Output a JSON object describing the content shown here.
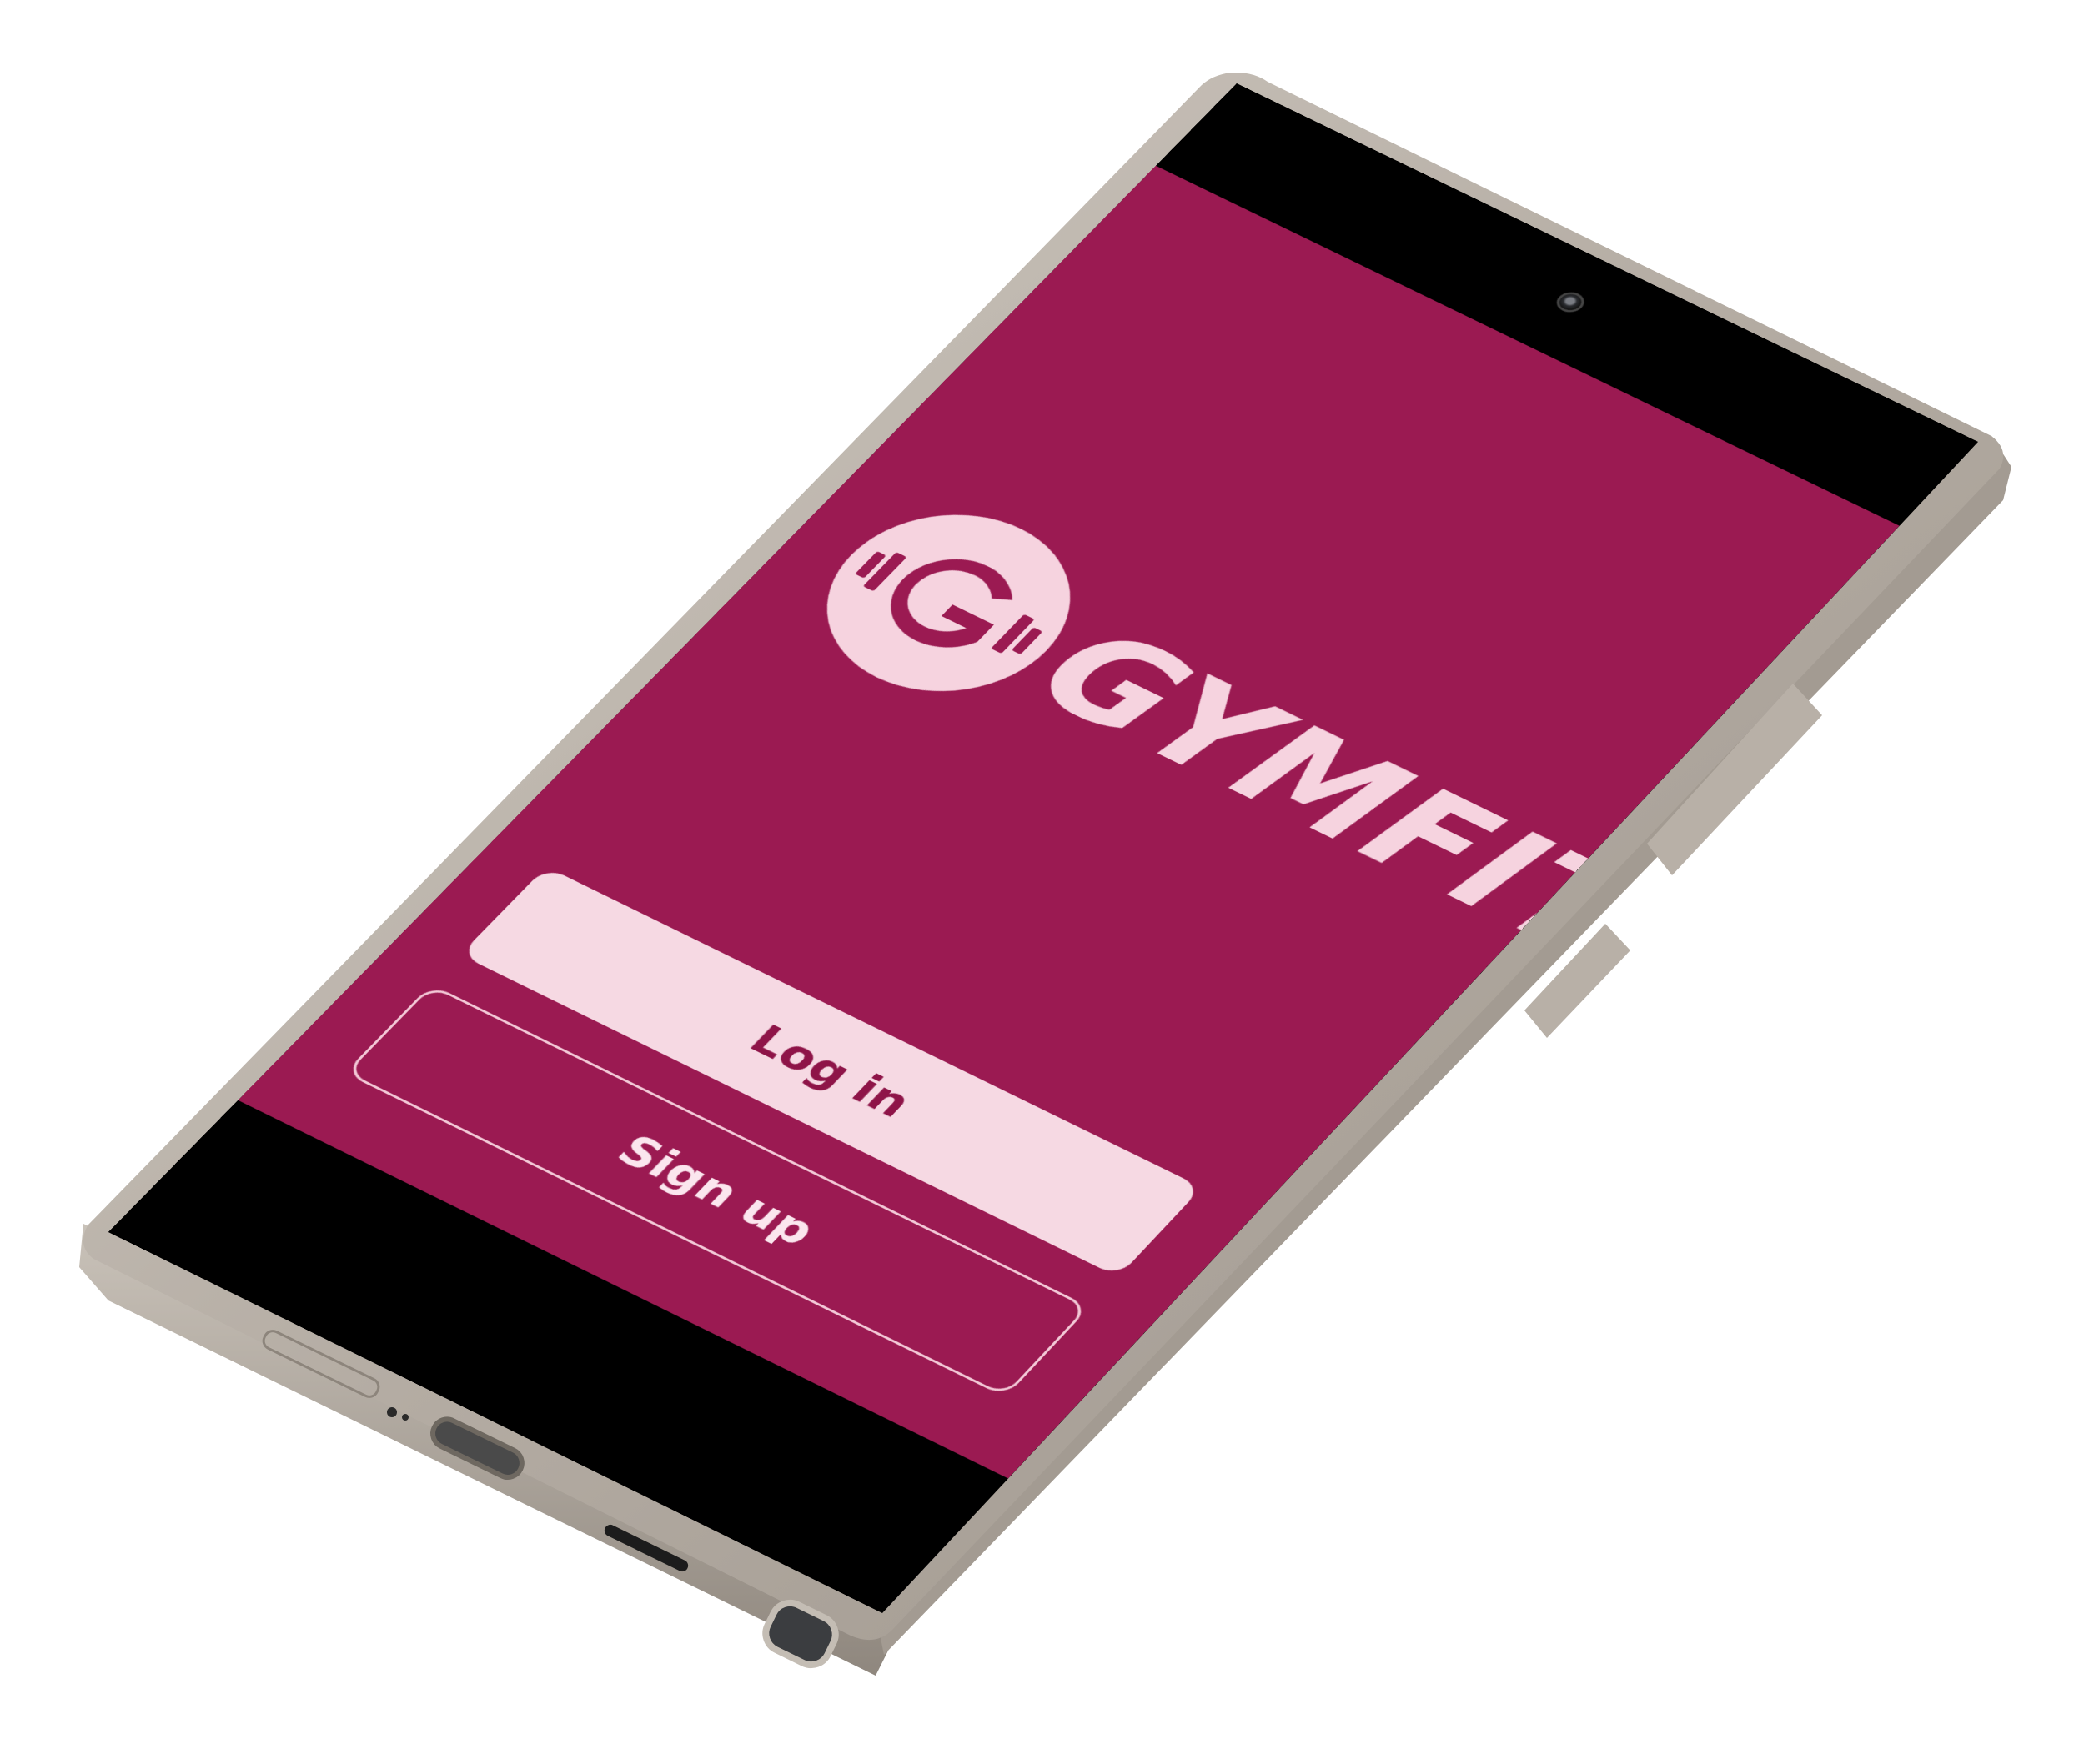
{
  "app": {
    "brand_name": "GYMFIT",
    "logo_letter": "G"
  },
  "buttons": {
    "login_label": "Log in",
    "signup_label": "Sign up"
  },
  "colors": {
    "primary": "#9b1a52",
    "accent_light": "#f6d9e3",
    "bezel": "#000000",
    "frame": "#b5ada4"
  }
}
